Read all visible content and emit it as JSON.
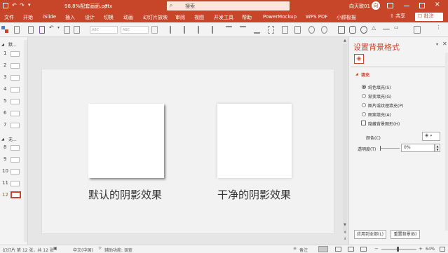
{
  "titlebar": {
    "filename": "98.8%配套画面.pptx",
    "filename_suffix": "▾",
    "search_placeholder": "搜索",
    "user": "向天歌01",
    "user_initial": "向",
    "share_label": "共享",
    "comment_label": "批注"
  },
  "menu": [
    "文件",
    "开始",
    "iSlide",
    "插入",
    "设计",
    "切换",
    "动画",
    "幻灯片放映",
    "审阅",
    "视图",
    "开发工具",
    "帮助",
    "PowerMockup",
    "WPS PDF",
    "小顾极报"
  ],
  "toolbar": {
    "font_name_placeholder": "ABC",
    "font_size_placeholder": "ABC"
  },
  "thumbs": {
    "section1": "默...",
    "section2": "无...",
    "items": [
      "1",
      "2",
      "3",
      "4",
      "5",
      "6",
      "7",
      "8",
      "9",
      "10",
      "11",
      "12"
    ]
  },
  "slide": {
    "caption_left": "默认的阴影效果",
    "caption_right": "干净的阴影效果"
  },
  "panel": {
    "title": "设置背景格式",
    "fill_section": "填充",
    "options": [
      "纯色填充(S)",
      "渐变填充(G)",
      "图片或纹理填充(P)",
      "图案填充(A)"
    ],
    "hide_bg": "隐藏背景图形(H)",
    "color_label": "颜色(C)",
    "transparency_label": "透明度(T)",
    "transparency_value": "0%",
    "apply_all": "应用到全部(L)",
    "reset_bg": "重置背景(B)"
  },
  "status": {
    "slide_info": "幻灯片 第 12 张，共 12 张",
    "language": "中文(中国)",
    "accessibility": "辅助功能: 调查",
    "notes": "备注",
    "zoom": "64%"
  }
}
